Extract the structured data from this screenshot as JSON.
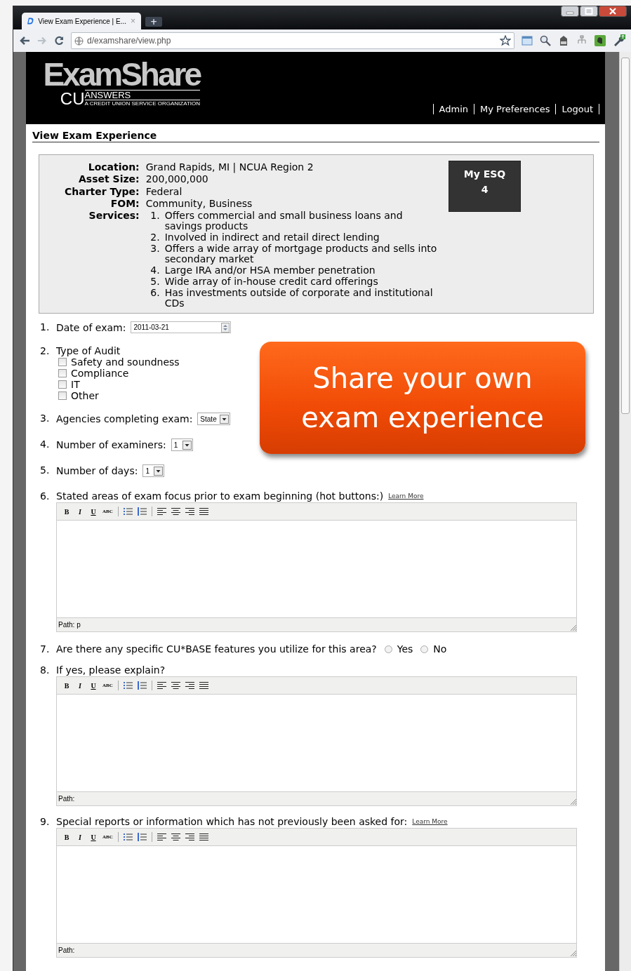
{
  "browser": {
    "tab_title": "View Exam Experience | E...",
    "tab_close": "×",
    "new_tab": "+",
    "url": "d/examshare/view.php"
  },
  "header": {
    "logo_main": "ExamShare",
    "logo_cu": "CU",
    "logo_answers": "ANSWERS",
    "logo_tagline": "A CREDIT UNION SERVICE ORGANIZATION",
    "nav": [
      "Admin",
      "My Preferences",
      "Logout"
    ]
  },
  "page_title": "View Exam Experience",
  "info": {
    "fields": [
      {
        "label": "Location:",
        "value": "Grand Rapids, MI | NCUA Region 2"
      },
      {
        "label": "Asset Size:",
        "value": "200,000,000"
      },
      {
        "label": "Charter Type:",
        "value": "Federal"
      },
      {
        "label": "FOM:",
        "value": "Community, Business"
      }
    ],
    "services_label": "Services:",
    "services": [
      {
        "number": "1.",
        "text": "Offers commercial and small business loans and savings products"
      },
      {
        "number": "2.",
        "text": "Involved in indirect and retail direct lending"
      },
      {
        "number": "3.",
        "text": "Offers a wide array of mortgage products and sells into secondary market"
      },
      {
        "number": "4.",
        "text": "Large IRA and/or HSA member penetration"
      },
      {
        "number": "5.",
        "text": "Wide array of in-house credit card offerings"
      },
      {
        "number": "6.",
        "text": "Has investments outside of corporate and institutional CDs"
      }
    ],
    "esq": {
      "label": "My ESQ",
      "value": "4"
    }
  },
  "questions": [
    {
      "kind": "date",
      "number": "1.",
      "label": "Date of exam:",
      "value": "2011-03-21"
    },
    {
      "kind": "checkboxes",
      "number": "2.",
      "label": "Type of Audit",
      "options": [
        {
          "label": "Safety and soundness",
          "checked": false
        },
        {
          "label": "Compliance",
          "checked": false
        },
        {
          "label": "IT",
          "checked": false
        },
        {
          "label": "Other",
          "checked": false
        }
      ]
    },
    {
      "kind": "select",
      "number": "3.",
      "label": "Agencies completing exam:",
      "value": "State"
    },
    {
      "kind": "select",
      "number": "4.",
      "label": "Number of examiners:",
      "value": "1"
    },
    {
      "kind": "select",
      "number": "5.",
      "label": "Number of days:",
      "value": "1"
    },
    {
      "kind": "editor",
      "number": "6.",
      "label": "Stated areas of exam focus prior to exam beginning (hot buttons:)",
      "link": "Learn More",
      "toolbar": [
        "B",
        "I",
        "U",
        "ABC"
      ],
      "path": "Path: p"
    },
    {
      "kind": "radio",
      "number": "7.",
      "label": "Are there any specific CU*BASE features you utilize for this area?",
      "options": [
        {
          "label": "Yes",
          "selected": false
        },
        {
          "label": "No",
          "selected": false
        }
      ]
    },
    {
      "kind": "editor",
      "number": "8.",
      "label": "If yes, please explain?",
      "toolbar": [
        "B",
        "I",
        "U",
        "ABC"
      ],
      "path": "Path:"
    },
    {
      "kind": "editor",
      "number": "9.",
      "label": "Special reports or information which has not previously been asked for:",
      "link": "Learn More",
      "toolbar": [
        "B",
        "I",
        "U",
        "ABC"
      ],
      "path": "Path:"
    }
  ],
  "callout": {
    "lines": [
      "Share your own",
      "exam experience"
    ]
  }
}
